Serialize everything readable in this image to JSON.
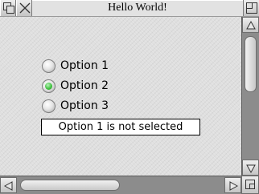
{
  "window": {
    "title": "Hello World!",
    "icons": {
      "back": "back-icon",
      "close": "close-icon",
      "toggle_size": "toggle-size-icon",
      "adjust_size": "adjust-size-icon"
    }
  },
  "radio_group": {
    "options": [
      {
        "label": "Option 1",
        "selected": false
      },
      {
        "label": "Option 2",
        "selected": true
      },
      {
        "label": "Option 3",
        "selected": false
      }
    ],
    "accent_color": "#43c443"
  },
  "status": {
    "text": "Option 1 is not selected"
  },
  "colors": {
    "work_area": "#dfdfdf",
    "title_bar": "#e2e2e2",
    "scroll_trough": "#8c8c8c"
  }
}
